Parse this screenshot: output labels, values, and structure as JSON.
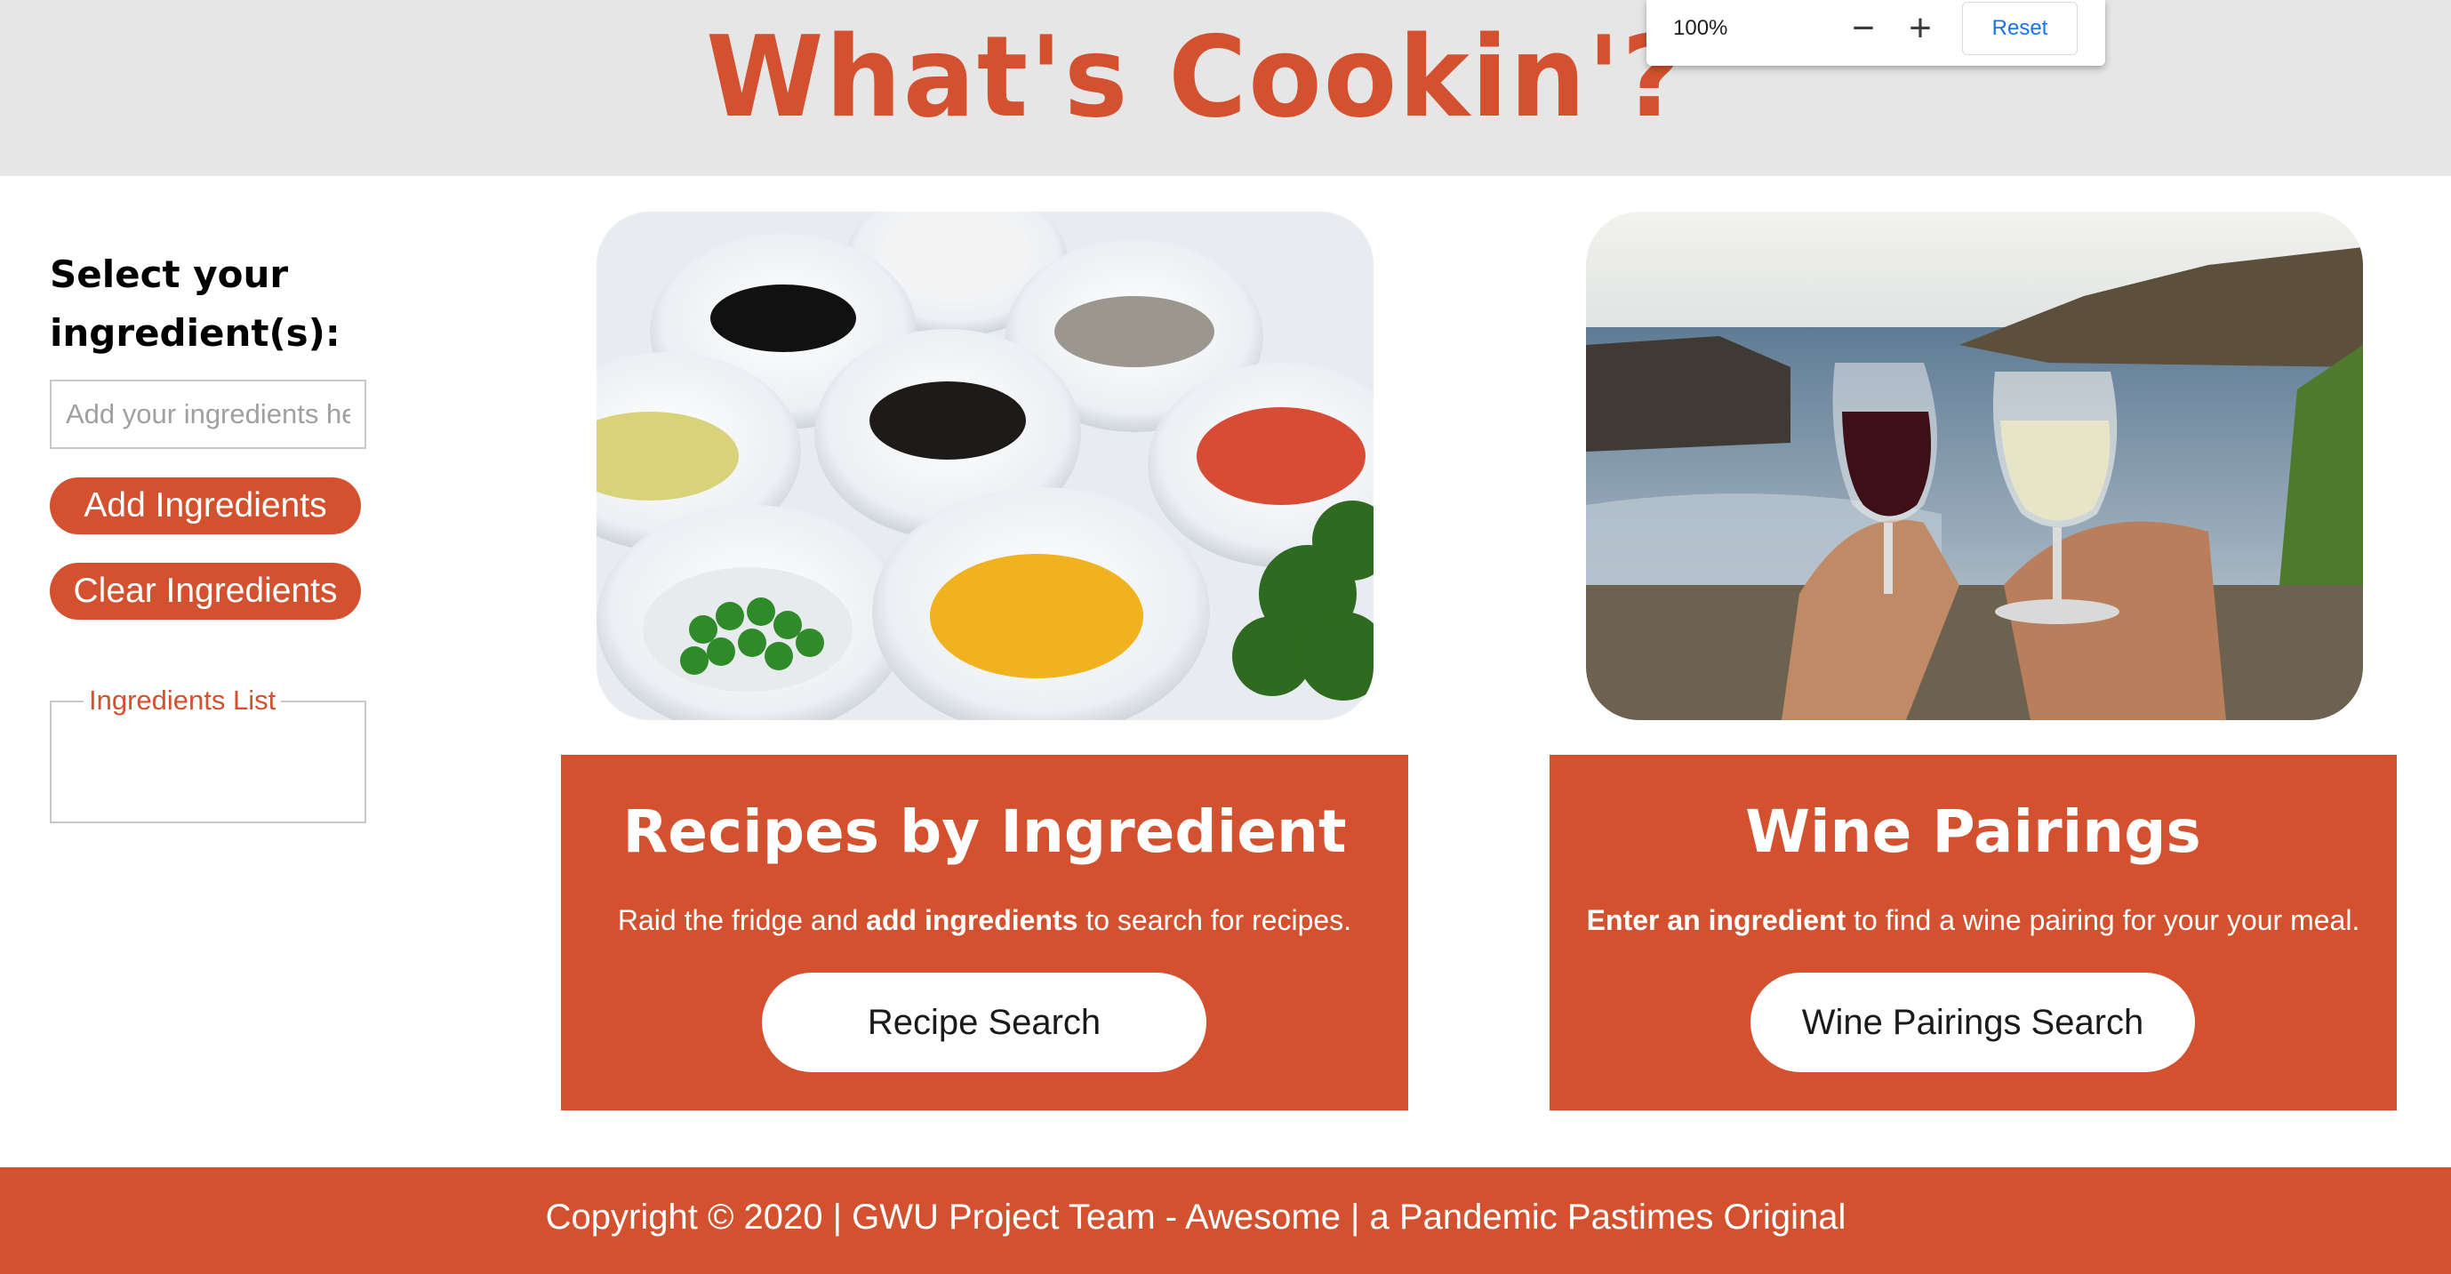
{
  "header": {
    "title": "What's Cookin'?"
  },
  "zoom_popup": {
    "level": "100%",
    "minus_icon": "minus-icon",
    "plus_icon": "plus-icon",
    "reset_label": "Reset"
  },
  "sidebar": {
    "heading": "Select your ingredient(s):",
    "input_placeholder": "Add your ingredients here",
    "add_button": "Add Ingredients",
    "clear_button": "Clear Ingredients",
    "list_legend": "Ingredients List"
  },
  "cards": {
    "recipes": {
      "title": "Recipes by Ingredient",
      "desc_prefix": "Raid the fridge and ",
      "desc_bold": "add ingredients",
      "desc_suffix": " to search for recipes.",
      "button": "Recipe Search"
    },
    "wine": {
      "title": "Wine Pairings",
      "desc_bold": "Enter an ingredient",
      "desc_suffix": " to find a wine pairing for your your meal.",
      "button": "Wine Pairings Search"
    }
  },
  "footer": {
    "text": "Copyright © 2020 | GWU Project Team - Awesome | a Pandemic Pastimes Original"
  },
  "colors": {
    "brand": "#d3512e",
    "header_bg": "#e6e6e6",
    "zoom_reset": "#1a73e8"
  }
}
